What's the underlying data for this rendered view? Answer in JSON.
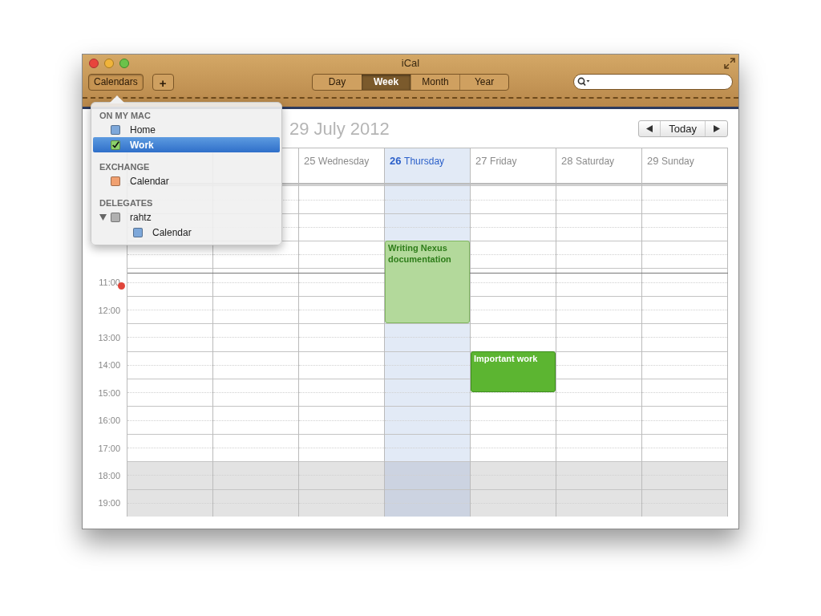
{
  "window": {
    "title": "iCal"
  },
  "toolbar": {
    "calendars_button": "Calendars",
    "add_button": "+",
    "view_tabs": [
      {
        "label": "Day",
        "selected": false
      },
      {
        "label": "Week",
        "selected": true
      },
      {
        "label": "Month",
        "selected": false
      },
      {
        "label": "Year",
        "selected": false
      }
    ]
  },
  "calendars_popover": {
    "sections": [
      {
        "heading": "ON MY MAC",
        "items": [
          {
            "label": "Home",
            "checked": false,
            "color": "#7ea8da",
            "selected": false
          },
          {
            "label": "Work",
            "checked": true,
            "color": "#8bd16a",
            "selected": true
          }
        ]
      },
      {
        "heading": "EXCHANGE",
        "items": [
          {
            "label": "Calendar",
            "checked": false,
            "color": "#f0a070",
            "selected": false
          }
        ]
      },
      {
        "heading": "DELEGATES",
        "items": [
          {
            "label": "rahtz",
            "checked": false,
            "color": "#b0b0b0",
            "selected": false,
            "expanded": true,
            "children": [
              {
                "label": "Calendar",
                "checked": false,
                "color": "#7ea8da",
                "selected": false
              }
            ]
          }
        ]
      }
    ]
  },
  "date_range": "29 July 2012",
  "today_button": "Today",
  "week": {
    "days": [
      {
        "today": false
      },
      {
        "today": false
      },
      {
        "number": "25",
        "name": "Wednesday",
        "today": false
      },
      {
        "number": "26",
        "name": "Thursday",
        "today": true,
        "events": [
          {
            "title": "Writing Nexus documentation",
            "selected": false
          }
        ]
      },
      {
        "number": "27",
        "name": "Friday",
        "today": false,
        "events": [
          {
            "title": "Important work",
            "selected": true
          }
        ]
      },
      {
        "number": "28",
        "name": "Saturday",
        "today": false
      },
      {
        "number": "29",
        "name": "Sunday",
        "today": false
      }
    ],
    "hour_rows": [
      {
        "after_hours": false
      },
      {
        "after_hours": false
      },
      {
        "after_hours": false
      },
      {
        "label": "11:00",
        "after_hours": false,
        "now_marker": true
      },
      {
        "label": "12:00",
        "after_hours": false
      },
      {
        "label": "13:00",
        "after_hours": false
      },
      {
        "label": "14:00",
        "after_hours": false
      },
      {
        "label": "15:00",
        "after_hours": false
      },
      {
        "label": "16:00",
        "after_hours": false
      },
      {
        "label": "17:00",
        "after_hours": false
      },
      {
        "label": "18:00",
        "after_hours": true
      },
      {
        "label": "19:00",
        "after_hours": true
      }
    ]
  }
}
